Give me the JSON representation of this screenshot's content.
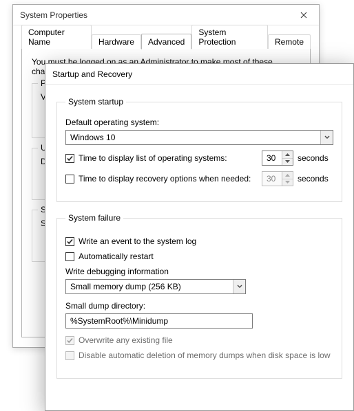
{
  "sysprops": {
    "title": "System Properties",
    "tabs": [
      "Computer Name",
      "Hardware",
      "Advanced",
      "System Protection",
      "Remote"
    ],
    "active_tab_index": 2,
    "admin_note": "You must be logged on as an Administrator to make most of these changes.",
    "perf_prefix": "Per",
    "visual_prefix": "Visu",
    "user_prefix": "Use",
    "desktop_prefix": "Des",
    "startup_prefix": "Star",
    "system_prefix": "Sys"
  },
  "startup": {
    "title": "Startup and Recovery",
    "section_startup": "System startup",
    "default_os_label": "Default operating system:",
    "default_os_value": "Windows 10",
    "time_list_label": "Time to display list of operating systems:",
    "time_list_value": "30",
    "time_list_checked": true,
    "time_recovery_label": "Time to display recovery options when needed:",
    "time_recovery_value": "30",
    "time_recovery_checked": false,
    "seconds": "seconds",
    "section_failure": "System failure",
    "write_event_label": "Write an event to the system log",
    "write_event_checked": true,
    "auto_restart_label": "Automatically restart",
    "auto_restart_checked": false,
    "write_debug_label": "Write debugging information",
    "debug_combo_value": "Small memory dump (256 KB)",
    "dump_dir_label": "Small dump directory:",
    "dump_dir_value": "%SystemRoot%\\Minidump",
    "overwrite_label": "Overwrite any existing file",
    "overwrite_checked": true,
    "disable_deletion_label": "Disable automatic deletion of memory dumps when disk space is low",
    "disable_deletion_checked": false
  }
}
